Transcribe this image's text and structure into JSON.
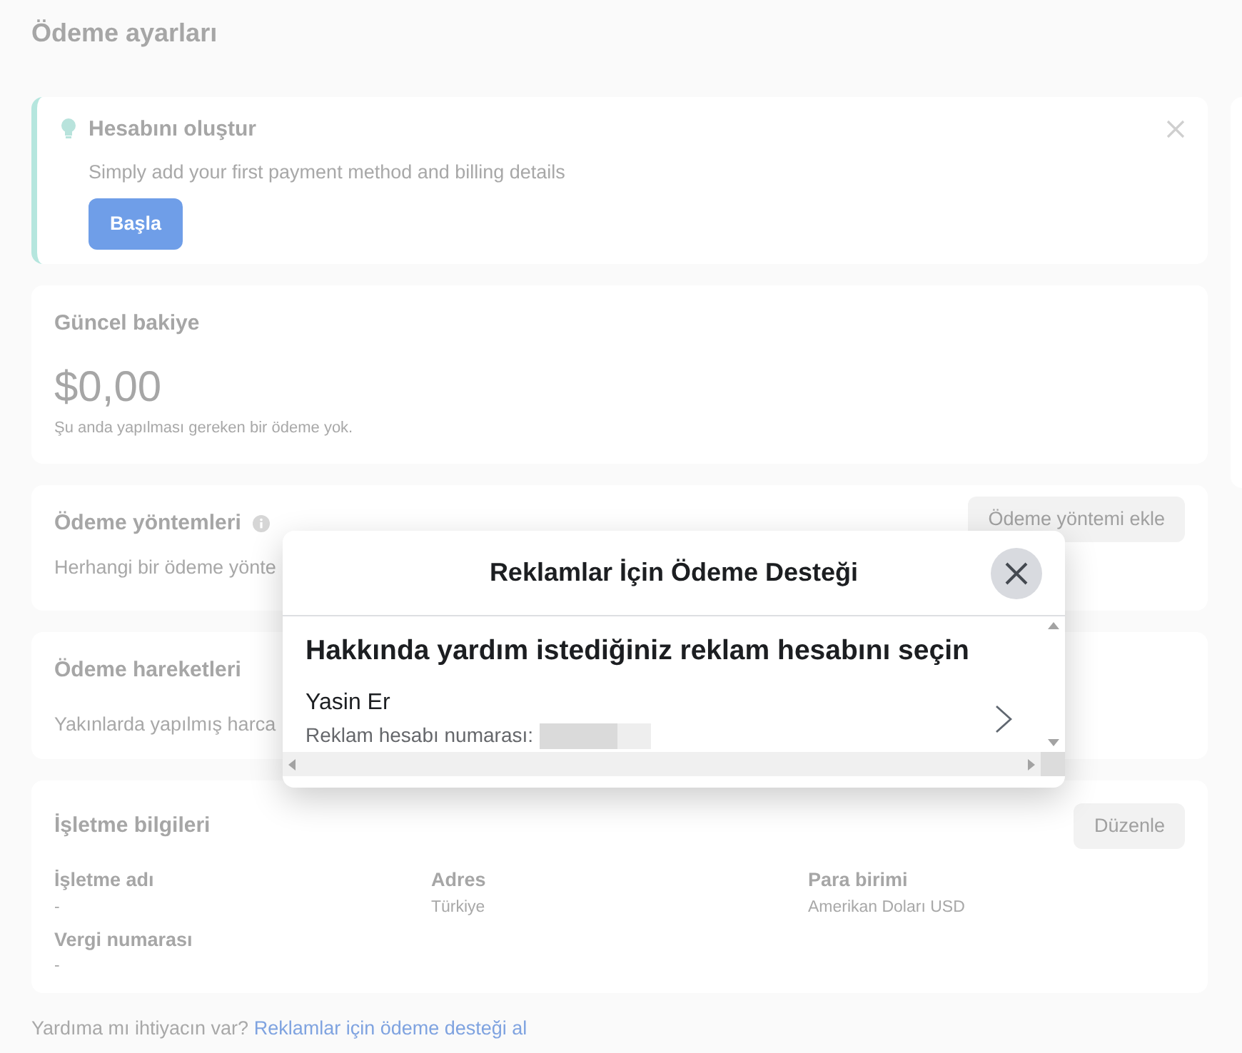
{
  "page": {
    "title": "Ödeme ayarları"
  },
  "banner": {
    "title": "Hesabını oluştur",
    "text": "Simply add your first payment method and billing details",
    "button": "Başla"
  },
  "balance": {
    "title": "Güncel bakiye",
    "amount": "$0,00",
    "note": "Şu anda yapılması gereken bir ödeme yok."
  },
  "payment_methods": {
    "title": "Ödeme yöntemleri",
    "text": "Herhangi bir ödeme yönte",
    "button": "Ödeme yöntemi ekle"
  },
  "transactions": {
    "title": "Ödeme hareketleri",
    "text": "Yakınlarda yapılmış harca"
  },
  "business": {
    "title": "İşletme bilgileri",
    "button": "Düzenle",
    "columns": [
      [
        {
          "label": "İşletme adı",
          "value": "-"
        },
        {
          "label": "Vergi numarası",
          "value": "-"
        }
      ],
      [
        {
          "label": "Adres",
          "value": "Türkiye"
        }
      ],
      [
        {
          "label": "Para birimi",
          "value": "Amerikan Doları USD"
        }
      ]
    ]
  },
  "footer": {
    "text": "Yardıma mı ihtiyacın var?",
    "link": "Reklamlar için ödeme desteği al"
  },
  "dialog": {
    "title": "Reklamlar İçin Ödeme Desteği",
    "heading": "Hakkında yardım istediğiniz reklam hesabını seçin",
    "accounts": [
      {
        "name": "Yasin Er",
        "number_label": "Reklam hesabı numarası:"
      }
    ]
  }
}
